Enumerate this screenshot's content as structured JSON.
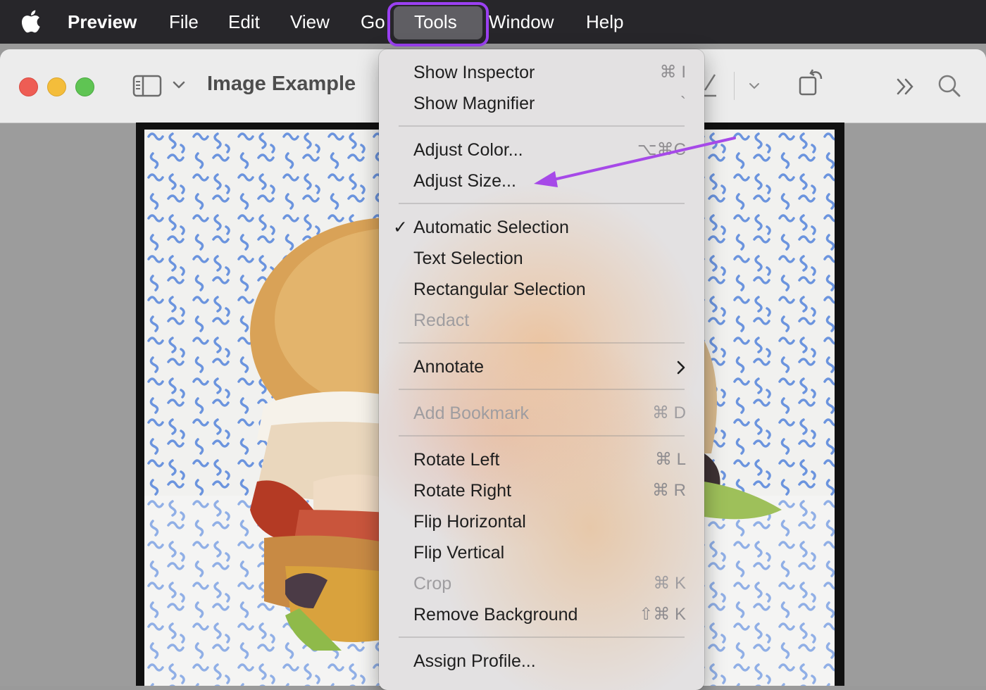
{
  "menubar": {
    "apple_icon": "apple-logo-icon",
    "items": [
      {
        "label": "Preview",
        "bold": true
      },
      {
        "label": "File"
      },
      {
        "label": "Edit"
      },
      {
        "label": "View"
      },
      {
        "label": "Go"
      },
      {
        "label": "Tools",
        "active": true
      },
      {
        "label": "Window"
      },
      {
        "label": "Help"
      }
    ]
  },
  "window": {
    "title": "Image Example",
    "icons": [
      "sidebar-toggle-icon",
      "chevron-down-icon",
      "markup-pen-icon",
      "chevron-down-icon",
      "rotate-icon",
      "more-chevrons-icon",
      "search-icon"
    ]
  },
  "tools_menu": {
    "items": [
      {
        "label": "Show Inspector",
        "shortcut": "⌘ I"
      },
      {
        "label": "Show Magnifier",
        "shortcut": "`"
      },
      {
        "label": "Adjust Color...",
        "shortcut": "⌥⌘C"
      },
      {
        "label": "Adjust Size..."
      },
      {
        "label": "Automatic Selection",
        "checked": true
      },
      {
        "label": "Text Selection"
      },
      {
        "label": "Rectangular Selection"
      },
      {
        "label": "Redact",
        "disabled": true
      },
      {
        "label": "Annotate",
        "submenu": true
      },
      {
        "label": "Add Bookmark",
        "shortcut": "⌘ D",
        "disabled": true
      },
      {
        "label": "Rotate Left",
        "shortcut": "⌘ L"
      },
      {
        "label": "Rotate Right",
        "shortcut": "⌘ R"
      },
      {
        "label": "Flip Horizontal"
      },
      {
        "label": "Flip Vertical"
      },
      {
        "label": "Crop",
        "shortcut": "⌘ K",
        "disabled": true
      },
      {
        "label": "Remove Background",
        "shortcut": "⇧⌘ K"
      },
      {
        "label": "Assign Profile..."
      }
    ]
  },
  "annotation": {
    "highlight_color": "#9b40f2",
    "arrow_color": "#a649e8",
    "highlighted_menu": "Tools",
    "arrow_target": "Adjust Size..."
  }
}
